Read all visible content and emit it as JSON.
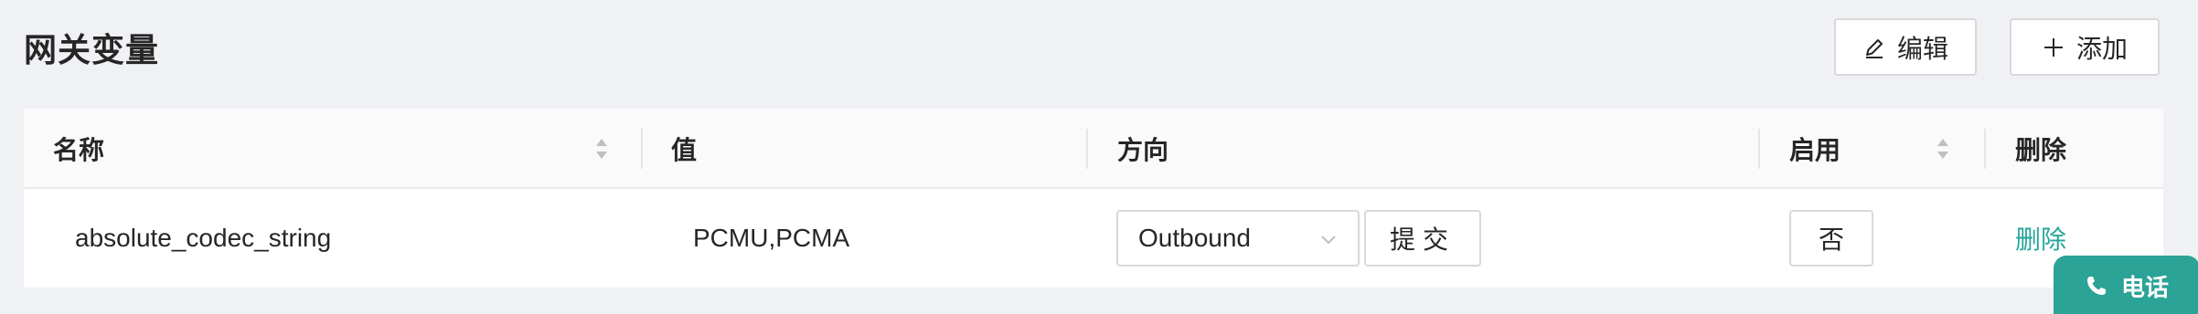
{
  "page": {
    "title": "网关变量",
    "edit_button": "编辑",
    "add_button": "添加"
  },
  "table": {
    "columns": {
      "name": "名称",
      "value": "值",
      "direction": "方向",
      "enabled": "启用",
      "delete": "删除"
    },
    "rows": [
      {
        "name": "absolute_codec_string",
        "value": "PCMU,PCMA",
        "direction": "Outbound",
        "submit": "提交",
        "enabled": "否",
        "delete": "删除"
      }
    ]
  },
  "fab": {
    "label": "电话"
  },
  "colors": {
    "accent": "#26a69a",
    "fab": "#2ba396"
  }
}
